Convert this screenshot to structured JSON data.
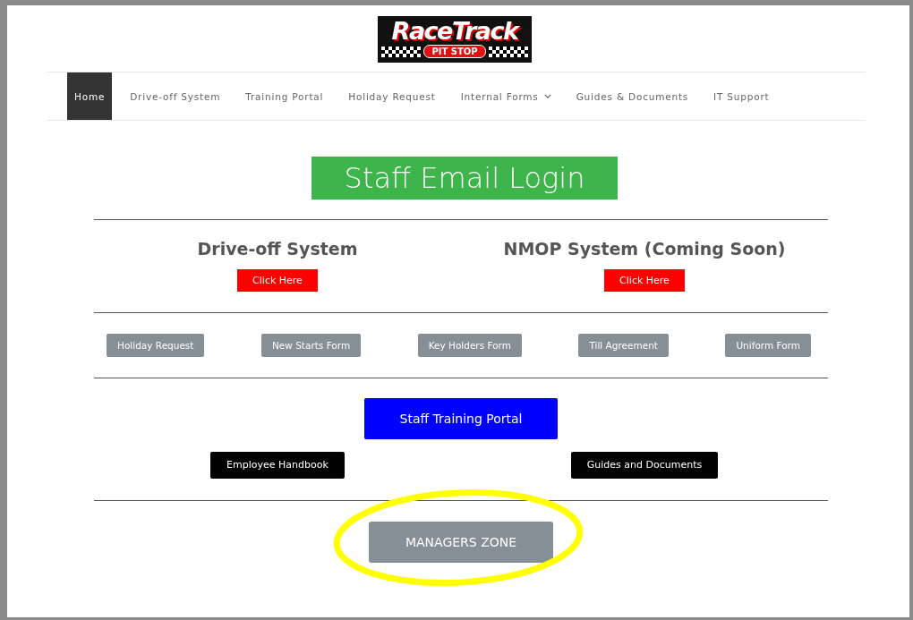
{
  "logo": {
    "title": "RaceTrack",
    "subtitle": "PIT STOP"
  },
  "nav": [
    {
      "label": "Home",
      "selected": true,
      "dropdown": false
    },
    {
      "label": "Drive-off System",
      "selected": false,
      "dropdown": false
    },
    {
      "label": "Training Portal",
      "selected": false,
      "dropdown": false
    },
    {
      "label": "Holiday Request",
      "selected": false,
      "dropdown": false
    },
    {
      "label": "Internal Forms",
      "selected": false,
      "dropdown": true
    },
    {
      "label": "Guides & Documents",
      "selected": false,
      "dropdown": false
    },
    {
      "label": "IT Support",
      "selected": false,
      "dropdown": false
    }
  ],
  "email_button": "Staff Email Login",
  "systems": [
    {
      "heading": "Drive-off System",
      "button": "Click Here"
    },
    {
      "heading": "NMOP System (Coming Soon)",
      "button": "Click Here"
    }
  ],
  "forms": [
    "Holiday Request",
    "New Starts Form",
    "Key Holders Form",
    "Till Agreement",
    "Uniform Form"
  ],
  "training_button": "Staff Training Portal",
  "document_buttons": [
    "Employee Handbook",
    "Guides and Documents"
  ],
  "managers_button": {
    "label": "MANAGERS ZONE",
    "highlighted": true
  }
}
